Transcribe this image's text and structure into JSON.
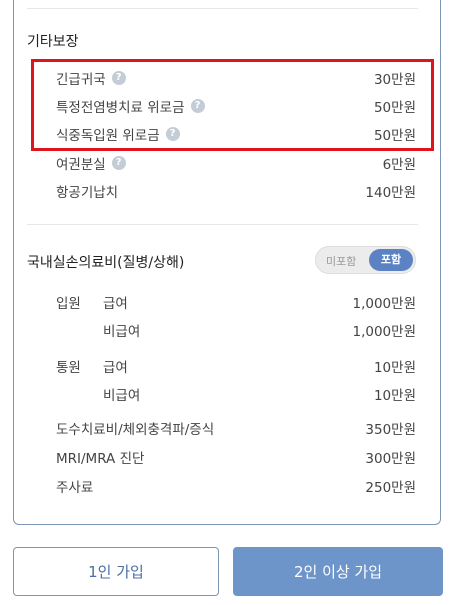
{
  "other_coverage": {
    "title": "기타보장",
    "items": [
      {
        "label": "긴급귀국",
        "value": "30만원",
        "help": true
      },
      {
        "label": "특정전염병치료 위로금",
        "value": "50만원",
        "help": true
      },
      {
        "label": "식중독입원 위로금",
        "value": "50만원",
        "help": true
      },
      {
        "label": "여권분실",
        "value": "6만원",
        "help": true
      },
      {
        "label": "항공기납치",
        "value": "140만원",
        "help": false
      }
    ]
  },
  "domestic": {
    "title": "국내실손의료비(질병/상해)",
    "toggle": {
      "off_label": "미포함",
      "on_label": "포함"
    },
    "inpatient": {
      "label": "입원",
      "covered_label": "급여",
      "covered_value": "1,000만원",
      "noncovered_label": "비급여",
      "noncovered_value": "1,000만원"
    },
    "outpatient": {
      "label": "통원",
      "covered_label": "급여",
      "covered_value": "10만원",
      "noncovered_label": "비급여",
      "noncovered_value": "10만원"
    },
    "extras": [
      {
        "label": "도수치료비/체외충격파/증식",
        "value": "350만원"
      },
      {
        "label": "MRI/MRA 진단",
        "value": "300만원"
      },
      {
        "label": "주사료",
        "value": "250만원"
      }
    ]
  },
  "buttons": {
    "single": "1인 가입",
    "multi": "2인 이상 가입"
  },
  "help_glyph": "?",
  "colors": {
    "highlight": "#e0141b",
    "accent": "#6d95ca",
    "border": "#7c97b3"
  }
}
